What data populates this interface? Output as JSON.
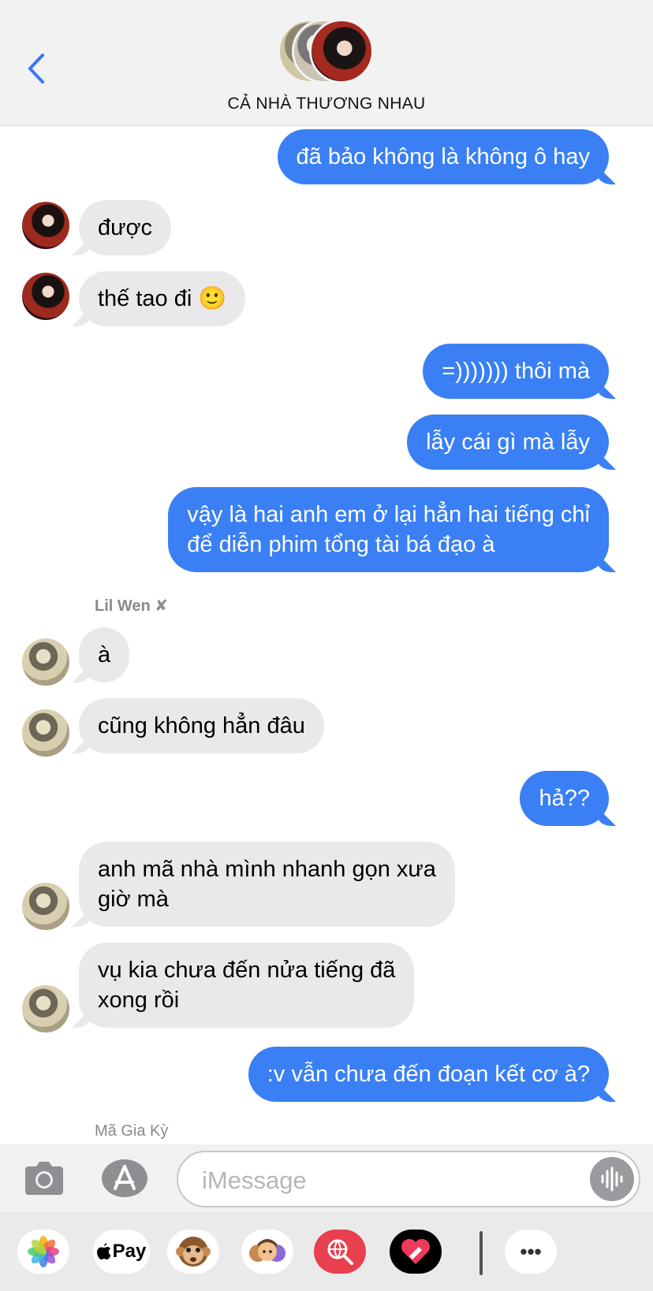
{
  "header": {
    "group_name": "CẢ NHÀ THƯƠNG NHAU"
  },
  "messages": [
    {
      "dir": "out",
      "text": "đã bảo không là không ô hay"
    },
    {
      "dir": "in",
      "text": "được"
    },
    {
      "dir": "in",
      "text": "thế tao đi 🙂"
    },
    {
      "dir": "out",
      "text": "=))))))) thôi mà"
    },
    {
      "dir": "out",
      "text": "lẫy cái gì mà lẫy"
    },
    {
      "dir": "out",
      "text": "vậy là hai anh em ở lại hẳn hai tiếng chỉ\nđể diễn phim tổng tài bá đạo à"
    },
    {
      "dir": "in",
      "text": "à"
    },
    {
      "dir": "in",
      "text": "cũng không hẳn đâu"
    },
    {
      "dir": "out",
      "text": "hả??"
    },
    {
      "dir": "in",
      "text": "anh mã nhà mình nhanh gọn xưa\ngiờ mà"
    },
    {
      "dir": "in",
      "text": "vụ kia chưa đến nửa tiếng đã\nxong rồi"
    },
    {
      "dir": "out",
      "text": ":v vẫn chưa đến đoạn kết cơ à?"
    }
  ],
  "senders": {
    "lil_wen": "Lil Wen ✘",
    "ma_gia_ky": "Mã Gia Kỳ"
  },
  "input": {
    "placeholder": "iMessage"
  },
  "app_drawer": {
    "apple_pay_label": "Pay",
    "more_label": "•••",
    "apps": [
      "photos-icon",
      "apple-pay-icon",
      "memoji-icon",
      "memoji-stickers-icon",
      "search-images-icon",
      "digital-touch-icon",
      "more-icon"
    ]
  },
  "colors": {
    "outgoing": "#3a80f4",
    "incoming": "#e9e9eb",
    "accent": "#3478f6"
  }
}
